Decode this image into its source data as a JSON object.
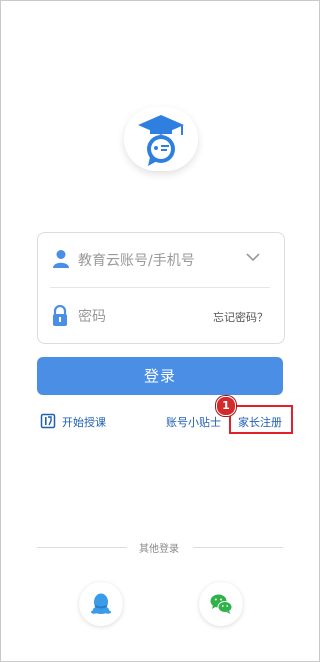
{
  "colors": {
    "accent": "#4a8ee6",
    "link": "#1f5fb5",
    "highlight_box": "#e0202a",
    "badge": "#d42a2a",
    "qq": "#3a9be8",
    "wechat": "#2fb24a"
  },
  "logo": {
    "icon": "graduation-cap-chat-icon"
  },
  "form": {
    "account_placeholder": "教育云账号/手机号",
    "account_icon": "user-icon",
    "account_dropdown_icon": "chevron-down-icon",
    "password_placeholder": "密码",
    "password_icon": "lock-icon",
    "forgot_label": "忘记密码？"
  },
  "login_button": "登录",
  "links": {
    "start_teaching": "开始授课",
    "start_teaching_icon": "book-icon",
    "account_tips": "账号小贴士",
    "parent_register": "家长注册"
  },
  "annotation": {
    "badge_number": "1"
  },
  "other_login": {
    "label": "其他登录",
    "providers": [
      {
        "name": "QQ",
        "icon": "qq-icon"
      },
      {
        "name": "WeChat",
        "icon": "wechat-icon"
      }
    ]
  }
}
